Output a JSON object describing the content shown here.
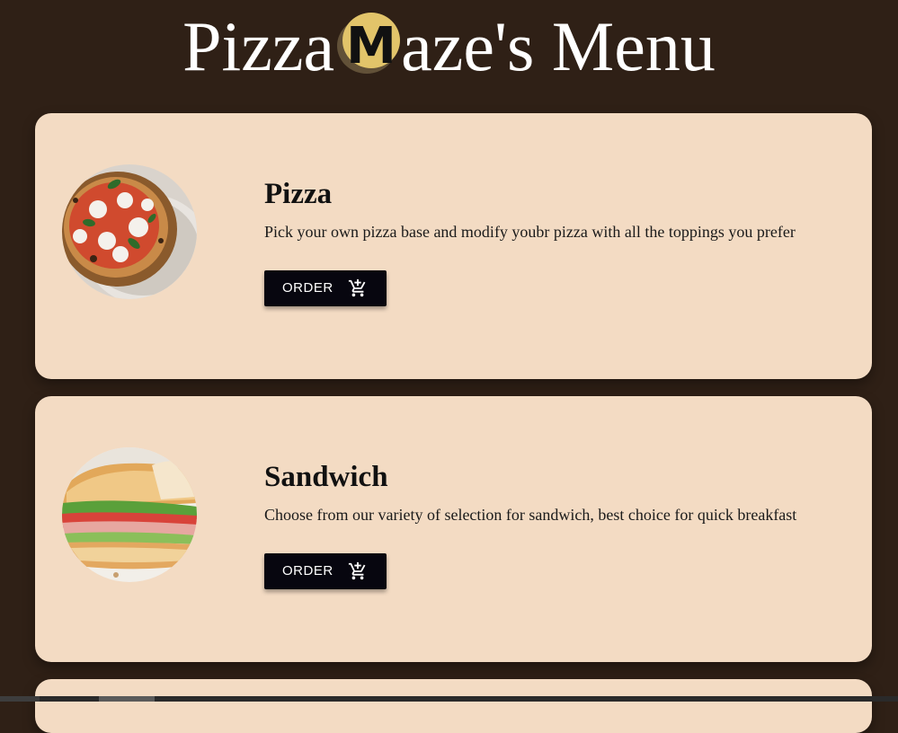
{
  "header": {
    "title_prefix": "Pizza",
    "title_logo_letter": "M",
    "title_suffix": "aze's Menu",
    "logo_icon": "maze-m-logo-icon"
  },
  "menu": {
    "items": [
      {
        "title": "Pizza",
        "description": "Pick your own pizza base and modify youbr pizza with all the toppings you prefer",
        "order_label": "ORDER",
        "image_icon": "pizza-photo",
        "cart_icon": "add-shopping-cart-icon"
      },
      {
        "title": "Sandwich",
        "description": "Choose from our variety of selection for sandwich, best choice for quick breakfast",
        "order_label": "ORDER",
        "image_icon": "sandwich-photo",
        "cart_icon": "add-shopping-cart-icon"
      }
    ]
  },
  "colors": {
    "background": "#2f2016",
    "card": "#f3dbc3",
    "button": "#07060f",
    "logo_gold": "#e2c46a"
  }
}
